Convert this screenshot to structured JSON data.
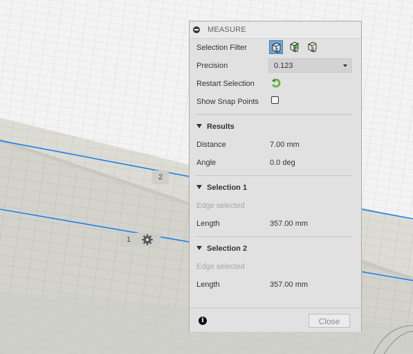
{
  "viewport": {
    "marker_1": "1",
    "marker_2": "2",
    "edge_color": "#1e7fe6"
  },
  "panel": {
    "title": "MEASURE",
    "selection_filter_label": "Selection Filter",
    "filter_icons": [
      "body-select-icon",
      "face-select-icon",
      "edge-select-icon"
    ],
    "precision_label": "Precision",
    "precision_value": "0.123",
    "restart_label": "Restart Selection",
    "snap_label": "Show Snap Points",
    "snap_checked": false,
    "results": {
      "heading": "Results",
      "distance_label": "Distance",
      "distance_value": "7.00 mm",
      "angle_label": "Angle",
      "angle_value": "0.0 deg"
    },
    "selection_1": {
      "heading": "Selection 1",
      "type": "Edge selected",
      "length_label": "Length",
      "length_value": "357.00 mm"
    },
    "selection_2": {
      "heading": "Selection 2",
      "type": "Edge selected",
      "length_label": "Length",
      "length_value": "357.00 mm"
    },
    "close_label": "Close"
  }
}
